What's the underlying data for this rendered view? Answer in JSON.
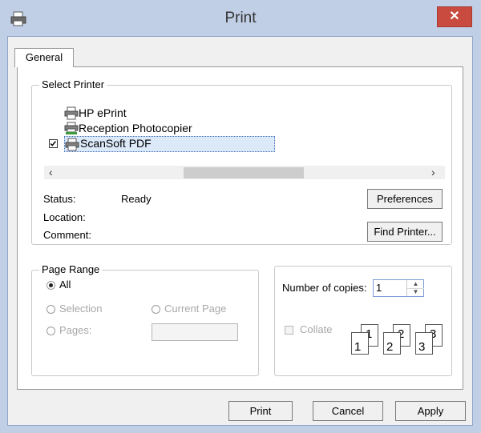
{
  "window": {
    "title": "Print",
    "close_glyph": "✕"
  },
  "tabs": [
    {
      "label": "General"
    }
  ],
  "select_printer": {
    "group_label": "Select Printer",
    "printers": [
      {
        "name": "HP ePrint",
        "icon": "printer-icon",
        "checked": false,
        "selected": false
      },
      {
        "name": "Reception Photocopier",
        "icon": "network-printer-icon",
        "checked": false,
        "selected": false
      },
      {
        "name": "ScanSoft PDF",
        "icon": "printer-icon",
        "checked": true,
        "selected": true
      }
    ],
    "scroll_left": "‹",
    "scroll_right": "›",
    "status_label": "Status:",
    "status_value": "Ready",
    "location_label": "Location:",
    "location_value": "",
    "comment_label": "Comment:",
    "comment_value": "",
    "preferences_label": "Preferences",
    "find_printer_label": "Find Printer..."
  },
  "page_range": {
    "group_label": "Page Range",
    "all_label": "All",
    "selection_label": "Selection",
    "current_page_label": "Current Page",
    "pages_label": "Pages:",
    "pages_value": "",
    "selected_option": "All"
  },
  "copies": {
    "number_label": "Number of copies:",
    "number_value": "1",
    "collate_label": "Collate",
    "collate_checked": false,
    "collate_pages": [
      "1",
      "1",
      "2",
      "2",
      "3",
      "3"
    ]
  },
  "footer": {
    "print_label": "Print",
    "cancel_label": "Cancel",
    "apply_label": "Apply"
  },
  "colors": {
    "titlebar": "#c0cfe6",
    "close_button": "#c94a3f",
    "selection_highlight": "#dbe9f9"
  }
}
